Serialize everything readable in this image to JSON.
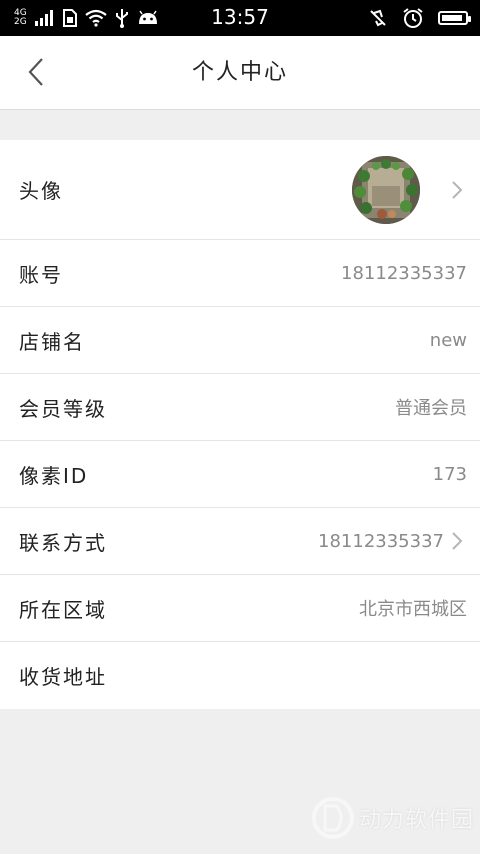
{
  "status_bar": {
    "network_top": "4G",
    "network_bottom": "2G",
    "time": "13:57"
  },
  "header": {
    "title": "个人中心"
  },
  "rows": [
    {
      "label": "头像",
      "value": ""
    },
    {
      "label": "账号",
      "value": "18112335337"
    },
    {
      "label": "店铺名",
      "value": "new"
    },
    {
      "label": "会员等级",
      "value": "普通会员"
    },
    {
      "label": "像素ID",
      "value": "173"
    },
    {
      "label": "联系方式",
      "value": "18112335337"
    },
    {
      "label": "所在区域",
      "value": "北京市西城区"
    },
    {
      "label": "收货地址",
      "value": ""
    }
  ],
  "watermark": {
    "text": "动力软件园"
  }
}
